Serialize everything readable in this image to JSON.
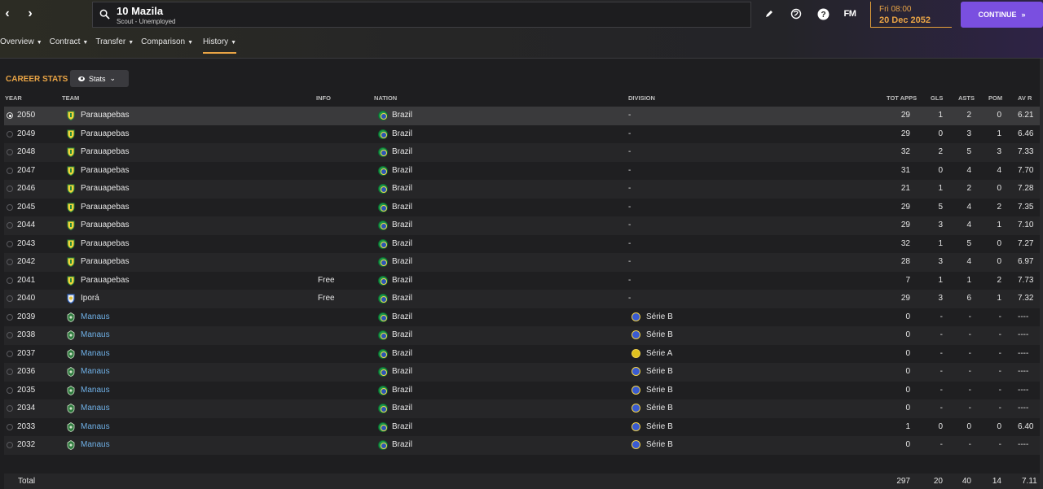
{
  "header": {
    "person_name": "10 Mazila",
    "person_subtitle": "Scout - Unemployed",
    "date_day": "Fri 08:00",
    "date_full": "20 Dec 2052",
    "continue_label": "CONTINUE",
    "fm_label": "FM",
    "icons": [
      "back-arrow-icon",
      "forward-arrow-icon",
      "search-icon",
      "edit-icon",
      "globe-icon",
      "help-icon",
      "fm-logo"
    ]
  },
  "tabs": [
    {
      "label": "Overview"
    },
    {
      "label": "Contract"
    },
    {
      "label": "Transfer"
    },
    {
      "label": "Comparison"
    },
    {
      "label": "History"
    }
  ],
  "section": {
    "title": "CAREER STATS",
    "view_dropdown": "Stats"
  },
  "columns": {
    "year": "YEAR",
    "team": "TEAM",
    "info": "INFO",
    "nation": "NATION",
    "division": "DIVISION",
    "apps": "TOT APPS",
    "gls": "GLS",
    "asts": "ASTS",
    "pom": "POM",
    "avr": "AV R"
  },
  "colors": {
    "accent": "#e9a445",
    "continue": "#7a4fe0",
    "link": "#6fb0e6"
  },
  "rows": [
    {
      "year": "2050",
      "team": "Parauapebas",
      "info": "",
      "nation": "Brazil",
      "division": "-",
      "apps": "29",
      "gls": "1",
      "asts": "2",
      "pom": "0",
      "avr": "6.21"
    },
    {
      "year": "2049",
      "team": "Parauapebas",
      "info": "",
      "nation": "Brazil",
      "division": "-",
      "apps": "29",
      "gls": "0",
      "asts": "3",
      "pom": "1",
      "avr": "6.46"
    },
    {
      "year": "2048",
      "team": "Parauapebas",
      "info": "",
      "nation": "Brazil",
      "division": "-",
      "apps": "32",
      "gls": "2",
      "asts": "5",
      "pom": "3",
      "avr": "7.33"
    },
    {
      "year": "2047",
      "team": "Parauapebas",
      "info": "",
      "nation": "Brazil",
      "division": "-",
      "apps": "31",
      "gls": "0",
      "asts": "4",
      "pom": "4",
      "avr": "7.70"
    },
    {
      "year": "2046",
      "team": "Parauapebas",
      "info": "",
      "nation": "Brazil",
      "division": "-",
      "apps": "21",
      "gls": "1",
      "asts": "2",
      "pom": "0",
      "avr": "7.28"
    },
    {
      "year": "2045",
      "team": "Parauapebas",
      "info": "",
      "nation": "Brazil",
      "division": "-",
      "apps": "29",
      "gls": "5",
      "asts": "4",
      "pom": "2",
      "avr": "7.35"
    },
    {
      "year": "2044",
      "team": "Parauapebas",
      "info": "",
      "nation": "Brazil",
      "division": "-",
      "apps": "29",
      "gls": "3",
      "asts": "4",
      "pom": "1",
      "avr": "7.10"
    },
    {
      "year": "2043",
      "team": "Parauapebas",
      "info": "",
      "nation": "Brazil",
      "division": "-",
      "apps": "32",
      "gls": "1",
      "asts": "5",
      "pom": "0",
      "avr": "7.27"
    },
    {
      "year": "2042",
      "team": "Parauapebas",
      "info": "",
      "nation": "Brazil",
      "division": "-",
      "apps": "28",
      "gls": "3",
      "asts": "4",
      "pom": "0",
      "avr": "6.97"
    },
    {
      "year": "2041",
      "team": "Parauapebas",
      "info": "Free",
      "nation": "Brazil",
      "division": "-",
      "apps": "7",
      "gls": "1",
      "asts": "1",
      "pom": "2",
      "avr": "7.73"
    },
    {
      "year": "2040",
      "team": "Iporá",
      "info": "Free",
      "nation": "Brazil",
      "division": "-",
      "apps": "29",
      "gls": "3",
      "asts": "6",
      "pom": "1",
      "avr": "7.32"
    },
    {
      "year": "2039",
      "team": "Manaus",
      "info": "",
      "nation": "Brazil",
      "division": "Série B",
      "apps": "0",
      "gls": "-",
      "asts": "-",
      "pom": "-",
      "avr": "----"
    },
    {
      "year": "2038",
      "team": "Manaus",
      "info": "",
      "nation": "Brazil",
      "division": "Série B",
      "apps": "0",
      "gls": "-",
      "asts": "-",
      "pom": "-",
      "avr": "----"
    },
    {
      "year": "2037",
      "team": "Manaus",
      "info": "",
      "nation": "Brazil",
      "division": "Série A",
      "apps": "0",
      "gls": "-",
      "asts": "-",
      "pom": "-",
      "avr": "----"
    },
    {
      "year": "2036",
      "team": "Manaus",
      "info": "",
      "nation": "Brazil",
      "division": "Série B",
      "apps": "0",
      "gls": "-",
      "asts": "-",
      "pom": "-",
      "avr": "----"
    },
    {
      "year": "2035",
      "team": "Manaus",
      "info": "",
      "nation": "Brazil",
      "division": "Série B",
      "apps": "0",
      "gls": "-",
      "asts": "-",
      "pom": "-",
      "avr": "----"
    },
    {
      "year": "2034",
      "team": "Manaus",
      "info": "",
      "nation": "Brazil",
      "division": "Série B",
      "apps": "0",
      "gls": "-",
      "asts": "-",
      "pom": "-",
      "avr": "----"
    },
    {
      "year": "2033",
      "team": "Manaus",
      "info": "",
      "nation": "Brazil",
      "division": "Série B",
      "apps": "1",
      "gls": "0",
      "asts": "0",
      "pom": "0",
      "avr": "6.40"
    },
    {
      "year": "2032",
      "team": "Manaus",
      "info": "",
      "nation": "Brazil",
      "division": "Série B",
      "apps": "0",
      "gls": "-",
      "asts": "-",
      "pom": "-",
      "avr": "----"
    }
  ],
  "totals": {
    "label": "Total",
    "apps": "297",
    "gls": "20",
    "asts": "40",
    "pom": "14",
    "avr": "7.11"
  }
}
